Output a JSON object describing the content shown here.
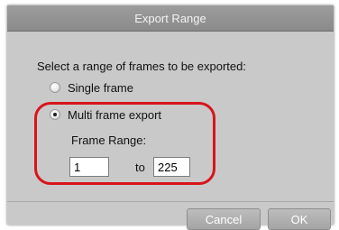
{
  "dialog": {
    "title": "Export Range",
    "prompt": "Select a range of frames to be exported:",
    "options": [
      {
        "label": "Single frame",
        "selected": false
      },
      {
        "label": "Multi frame export",
        "selected": true
      }
    ],
    "frame_range": {
      "label": "Frame Range:",
      "start": "1",
      "separator": "to",
      "end": "225"
    },
    "buttons": {
      "cancel": "Cancel",
      "ok": "OK"
    }
  },
  "colors": {
    "highlight": "#d8141b",
    "dialog_bg": "#c9c9c9",
    "titlebar": "#8f8f8f"
  }
}
